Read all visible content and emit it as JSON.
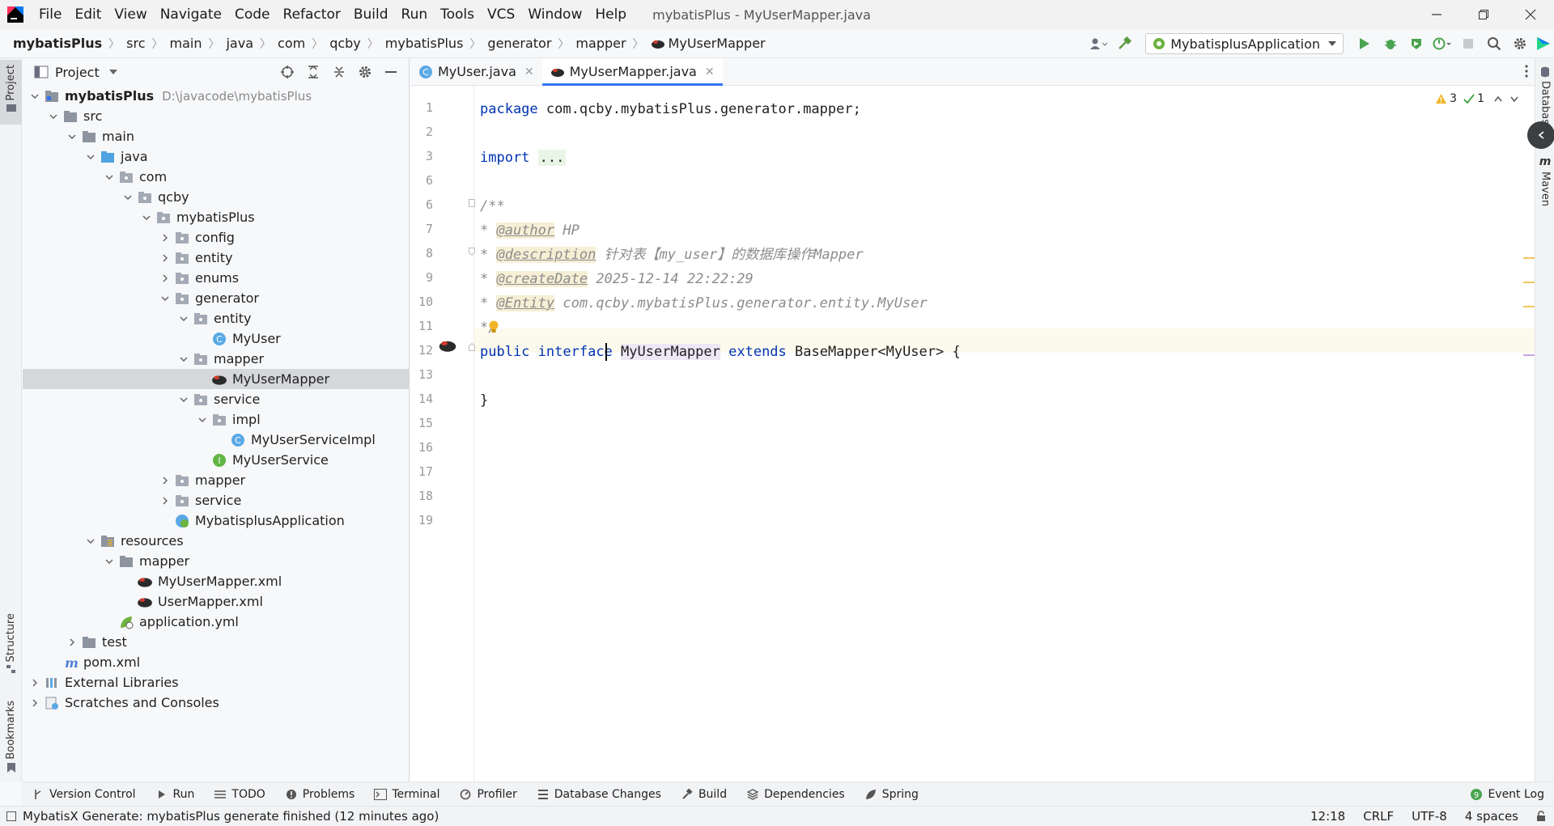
{
  "app": {
    "window_title": "mybatisPlus - MyUserMapper.java",
    "menu": [
      "File",
      "Edit",
      "View",
      "Navigate",
      "Code",
      "Refactor",
      "Build",
      "Run",
      "Tools",
      "VCS",
      "Window",
      "Help"
    ]
  },
  "breadcrumb": [
    "mybatisPlus",
    "src",
    "main",
    "java",
    "com",
    "qcby",
    "mybatisPlus",
    "generator",
    "mapper",
    "MyUserMapper"
  ],
  "toolbar": {
    "run_config": "MybatisplusApplication"
  },
  "left_strip": {
    "project": "Project",
    "structure": "Structure",
    "bookmarks": "Bookmarks"
  },
  "right_strip": {
    "database": "Database",
    "maven": "Maven"
  },
  "project_panel": {
    "title": "Project",
    "tree": [
      {
        "label": "mybatisPlus",
        "hint": "D:\\javacode\\mybatisPlus",
        "depth": 0,
        "expanded": true,
        "icon": "module-folder-icon",
        "bold": true
      },
      {
        "label": "src",
        "depth": 1,
        "expanded": true,
        "icon": "folder-icon"
      },
      {
        "label": "main",
        "depth": 2,
        "expanded": true,
        "icon": "folder-icon"
      },
      {
        "label": "java",
        "depth": 3,
        "expanded": true,
        "icon": "source-folder-icon"
      },
      {
        "label": "com",
        "depth": 4,
        "expanded": true,
        "icon": "package-icon"
      },
      {
        "label": "qcby",
        "depth": 5,
        "expanded": true,
        "icon": "package-icon"
      },
      {
        "label": "mybatisPlus",
        "depth": 6,
        "expanded": true,
        "icon": "package-icon"
      },
      {
        "label": "config",
        "depth": 7,
        "expanded": false,
        "icon": "package-icon"
      },
      {
        "label": "entity",
        "depth": 7,
        "expanded": false,
        "icon": "package-icon"
      },
      {
        "label": "enums",
        "depth": 7,
        "expanded": false,
        "icon": "package-icon"
      },
      {
        "label": "generator",
        "depth": 7,
        "expanded": true,
        "icon": "package-icon"
      },
      {
        "label": "entity",
        "depth": 8,
        "expanded": true,
        "icon": "package-icon"
      },
      {
        "label": "MyUser",
        "depth": 9,
        "icon": "class-icon"
      },
      {
        "label": "mapper",
        "depth": 8,
        "expanded": true,
        "icon": "package-icon"
      },
      {
        "label": "MyUserMapper",
        "depth": 9,
        "icon": "mybatis-icon",
        "selected": true
      },
      {
        "label": "service",
        "depth": 8,
        "expanded": true,
        "icon": "package-icon"
      },
      {
        "label": "impl",
        "depth": 9,
        "expanded": true,
        "icon": "package-icon"
      },
      {
        "label": "MyUserServiceImpl",
        "depth": 10,
        "icon": "class-icon"
      },
      {
        "label": "MyUserService",
        "depth": 9,
        "icon": "interface-icon"
      },
      {
        "label": "mapper",
        "depth": 7,
        "expanded": false,
        "icon": "package-icon"
      },
      {
        "label": "service",
        "depth": 7,
        "expanded": false,
        "icon": "package-icon"
      },
      {
        "label": "MybatisplusApplication",
        "depth": 7,
        "icon": "spring-app-icon"
      },
      {
        "label": "resources",
        "depth": 3,
        "expanded": true,
        "icon": "resources-folder-icon"
      },
      {
        "label": "mapper",
        "depth": 4,
        "expanded": true,
        "icon": "folder-icon"
      },
      {
        "label": "MyUserMapper.xml",
        "depth": 5,
        "icon": "mybatis-icon"
      },
      {
        "label": "UserMapper.xml",
        "depth": 5,
        "icon": "mybatis-icon"
      },
      {
        "label": "application.yml",
        "depth": 4,
        "icon": "spring-config-icon"
      },
      {
        "label": "test",
        "depth": 2,
        "expanded": false,
        "icon": "folder-icon"
      },
      {
        "label": "pom.xml",
        "depth": 1,
        "icon": "maven-icon"
      },
      {
        "label": "External Libraries",
        "depth": 0,
        "expanded": false,
        "icon": "libraries-icon"
      },
      {
        "label": "Scratches and Consoles",
        "depth": 0,
        "expanded": false,
        "icon": "scratches-icon"
      }
    ]
  },
  "editor": {
    "tabs": [
      {
        "label": "MyUser.java",
        "icon": "class-icon",
        "active": false
      },
      {
        "label": "MyUserMapper.java",
        "icon": "mybatis-icon",
        "active": true
      }
    ],
    "inspections": {
      "warnings": "3",
      "typos": "1"
    },
    "line_numbers": [
      "1",
      "2",
      "3",
      "6",
      "6",
      "7",
      "8",
      "9",
      "10",
      "11",
      "12",
      "13",
      "14",
      "15",
      "16",
      "17",
      "18",
      "19"
    ]
  },
  "code": {
    "l1_kw": "package",
    "l1_rest": " com.qcby.mybatisPlus.generator.mapper;",
    "l3_kw": "import",
    "l3_fold": "...",
    "l6": "/**",
    "l7_star": "* ",
    "l7_tag": "@author",
    "l7_rest": " HP",
    "l8_star": "* ",
    "l8_tag": "@description",
    "l8_rest": " 针对表【my_user】的数据库操作Mapper",
    "l9_star": "* ",
    "l9_tag": "@createDate",
    "l9_rest": " 2025-12-14 22:22:29",
    "l10_star": "* ",
    "l10_tag": "@Entity",
    "l10_rest": " com.qcby.mybatisPlus.generator.entity.MyUser",
    "l11": "*/",
    "l12_kw1": "public",
    "l12_kw2": "interface",
    "l12_ident": "MyUserMapper",
    "l12_kw3": "extends",
    "l12_rest": " BaseMapper<MyUser> {",
    "l14": "}"
  },
  "bottom_tools": [
    "Version Control",
    "Run",
    "TODO",
    "Problems",
    "Terminal",
    "Profiler",
    "Database Changes",
    "Build",
    "Dependencies",
    "Spring"
  ],
  "event_log": "Event Log",
  "status": {
    "message": "MybatisX Generate: mybatisPlus generate finished (12 minutes ago)",
    "position": "12:18",
    "line_sep": "CRLF",
    "encoding": "UTF-8",
    "indent": "4 spaces"
  },
  "colors": {
    "keyword": "#0033b3",
    "comment": "#8c8c8c",
    "accent": "#3574f0",
    "selection": "#d5d7db"
  }
}
